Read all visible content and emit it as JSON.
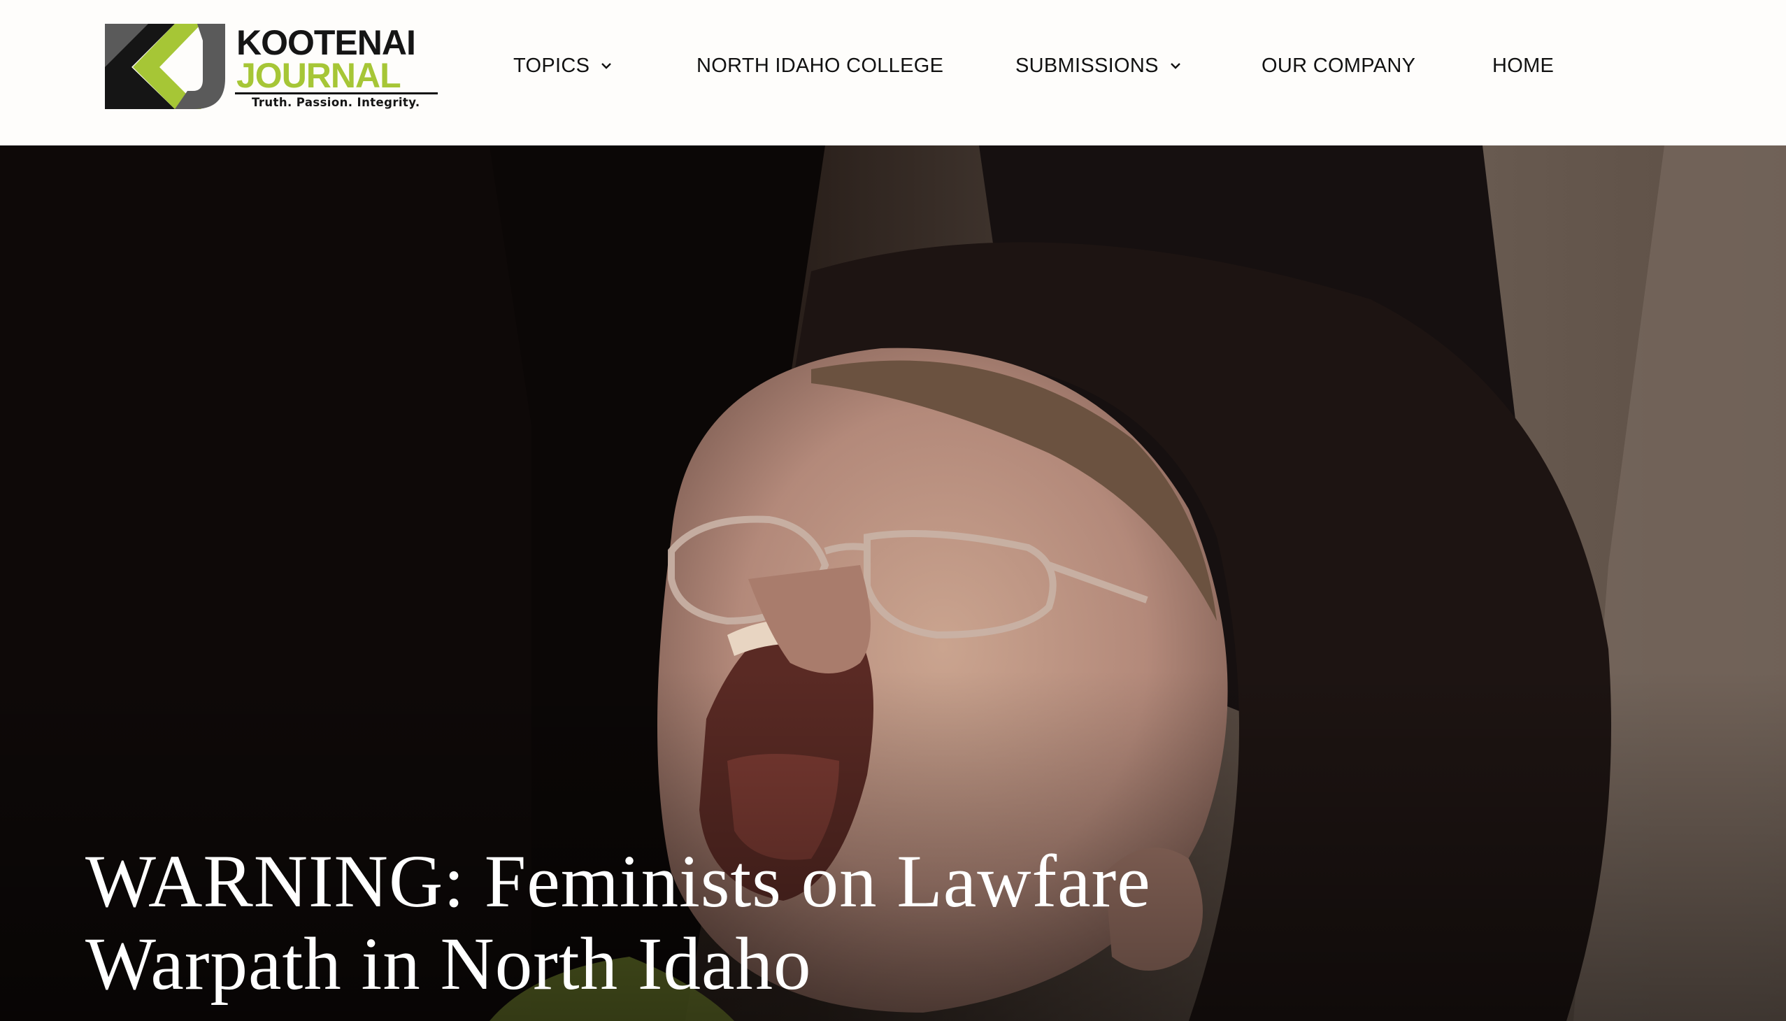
{
  "brand": {
    "name_line1": "KOOTENAI",
    "name_line2": "JOURNAL",
    "tagline": "Truth. Passion. Integrity.",
    "color_dark": "#151515",
    "color_accent": "#a6c636"
  },
  "nav": {
    "items": [
      {
        "label": "TOPICS",
        "has_dropdown": true
      },
      {
        "label": "NORTH IDAHO COLLEGE",
        "has_dropdown": false
      },
      {
        "label": "SUBMISSIONS",
        "has_dropdown": true
      },
      {
        "label": "OUR COMPANY",
        "has_dropdown": false
      },
      {
        "label": "HOME",
        "has_dropdown": false
      }
    ]
  },
  "hero": {
    "headline": "WARNING: Feminists on Lawfare Warpath in North Idaho"
  }
}
